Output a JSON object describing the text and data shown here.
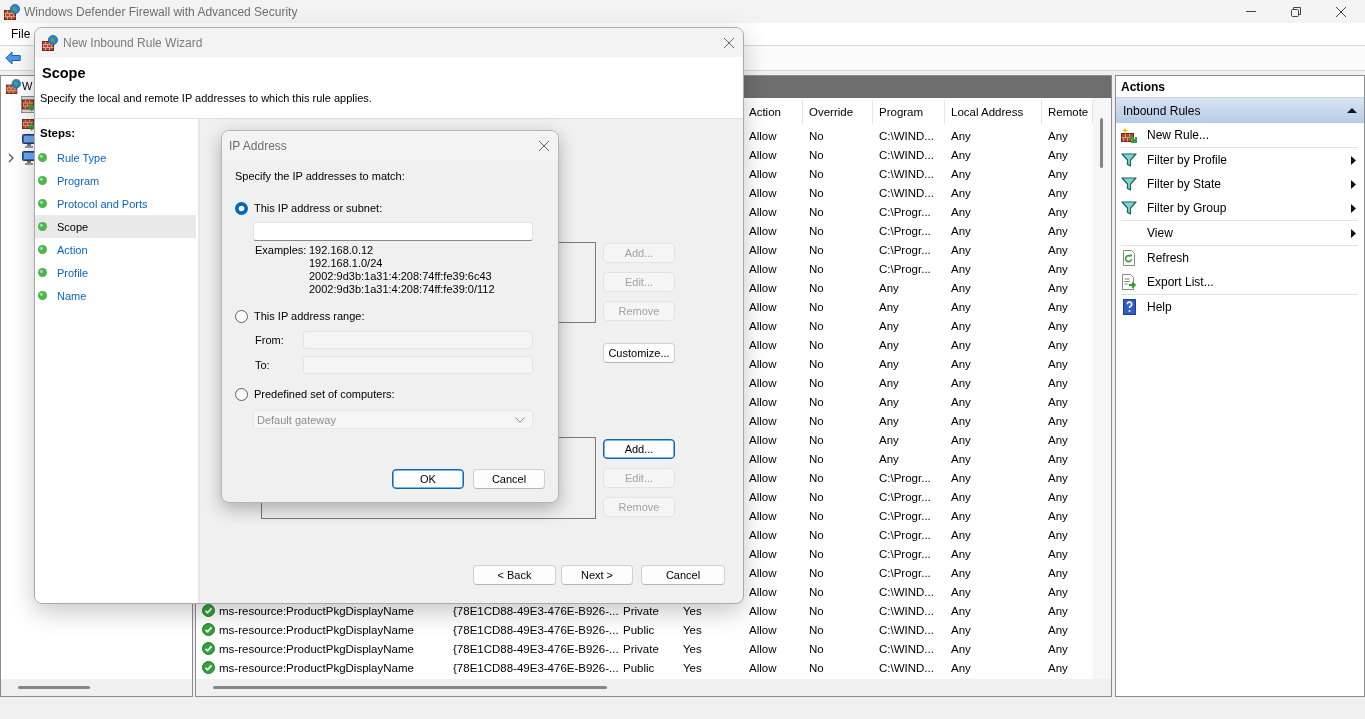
{
  "window": {
    "title": "Windows Defender Firewall with Advanced Security"
  },
  "menu": [
    "File"
  ],
  "tree": {
    "label": "W",
    "children": [
      {
        "kind": "wall",
        "selected": true,
        "collapsed": false
      },
      {
        "kind": "wall",
        "selected": false,
        "collapsed": false
      },
      {
        "kind": "monitor",
        "selected": false,
        "collapsed": false
      },
      {
        "kind": "monitor",
        "selected": false,
        "collapsed": true
      }
    ]
  },
  "table": {
    "headers": [
      "Action",
      "Override",
      "Program",
      "Local Address",
      "Remote"
    ],
    "rows": [
      {
        "action": "Allow",
        "override": "No",
        "program": "C:\\WIND...",
        "local_address": "Any",
        "remote": "Any"
      },
      {
        "action": "Allow",
        "override": "No",
        "program": "C:\\WIND...",
        "local_address": "Any",
        "remote": "Any"
      },
      {
        "action": "Allow",
        "override": "No",
        "program": "C:\\WIND...",
        "local_address": "Any",
        "remote": "Any"
      },
      {
        "action": "Allow",
        "override": "No",
        "program": "C:\\WIND...",
        "local_address": "Any",
        "remote": "Any"
      },
      {
        "action": "Allow",
        "override": "No",
        "program": "C:\\Progr...",
        "local_address": "Any",
        "remote": "Any"
      },
      {
        "action": "Allow",
        "override": "No",
        "program": "C:\\Progr...",
        "local_address": "Any",
        "remote": "Any"
      },
      {
        "action": "Allow",
        "override": "No",
        "program": "C:\\Progr...",
        "local_address": "Any",
        "remote": "Any"
      },
      {
        "action": "Allow",
        "override": "No",
        "program": "C:\\Progr...",
        "local_address": "Any",
        "remote": "Any"
      },
      {
        "action": "Allow",
        "override": "No",
        "program": "Any",
        "local_address": "Any",
        "remote": "Any"
      },
      {
        "action": "Allow",
        "override": "No",
        "program": "Any",
        "local_address": "Any",
        "remote": "Any"
      },
      {
        "action": "Allow",
        "override": "No",
        "program": "Any",
        "local_address": "Any",
        "remote": "Any"
      },
      {
        "action": "Allow",
        "override": "No",
        "program": "Any",
        "local_address": "Any",
        "remote": "Any"
      },
      {
        "action": "Allow",
        "override": "No",
        "program": "Any",
        "local_address": "Any",
        "remote": "Any"
      },
      {
        "action": "Allow",
        "override": "No",
        "program": "Any",
        "local_address": "Any",
        "remote": "Any"
      },
      {
        "action": "Allow",
        "override": "No",
        "program": "Any",
        "local_address": "Any",
        "remote": "Any"
      },
      {
        "action": "Allow",
        "override": "No",
        "program": "Any",
        "local_address": "Any",
        "remote": "Any"
      },
      {
        "action": "Allow",
        "override": "No",
        "program": "Any",
        "local_address": "Any",
        "remote": "Any"
      },
      {
        "action": "Allow",
        "override": "No",
        "program": "Any",
        "local_address": "Any",
        "remote": "Any"
      },
      {
        "action": "Allow",
        "override": "No",
        "program": "C:\\Progr...",
        "local_address": "Any",
        "remote": "Any"
      },
      {
        "action": "Allow",
        "override": "No",
        "program": "C:\\Progr...",
        "local_address": "Any",
        "remote": "Any"
      },
      {
        "action": "Allow",
        "override": "No",
        "program": "C:\\Progr...",
        "local_address": "Any",
        "remote": "Any"
      },
      {
        "action": "Allow",
        "override": "No",
        "program": "C:\\Progr...",
        "local_address": "Any",
        "remote": "Any"
      },
      {
        "action": "Allow",
        "override": "No",
        "program": "C:\\Progr...",
        "local_address": "Any",
        "remote": "Any"
      },
      {
        "action": "Allow",
        "override": "No",
        "program": "C:\\Progr...",
        "local_address": "Any",
        "remote": "Any"
      },
      {
        "action": "Allow",
        "override": "No",
        "program": "C:\\WIND...",
        "local_address": "Any",
        "remote": "Any"
      },
      {
        "column_1": "ms-resource:ProductPkgDisplayName",
        "column_2": "{78E1CD88-49E3-476E-B926-...",
        "column_3": "Private",
        "column_4": "Yes",
        "action": "Allow",
        "override": "No",
        "program": "C:\\WIND...",
        "local_address": "Any",
        "remote": "Any"
      },
      {
        "column_1": "ms-resource:ProductPkgDisplayName",
        "column_2": "{78E1CD88-49E3-476E-B926-...",
        "column_3": "Public",
        "column_4": "Yes",
        "action": "Allow",
        "override": "No",
        "program": "C:\\WIND...",
        "local_address": "Any",
        "remote": "Any"
      },
      {
        "column_1": "ms-resource:ProductPkgDisplayName",
        "column_2": "{78E1CD88-49E3-476E-B926-...",
        "column_3": "Private",
        "column_4": "Yes",
        "action": "Allow",
        "override": "No",
        "program": "C:\\WIND...",
        "local_address": "Any",
        "remote": "Any"
      },
      {
        "column_1": "ms-resource:ProductPkgDisplayName",
        "column_2": "{78E1CD88-49E3-476E-B926-...",
        "column_3": "Public",
        "column_4": "Yes",
        "action": "Allow",
        "override": "No",
        "program": "C:\\WIND...",
        "local_address": "Any",
        "remote": "Any"
      }
    ]
  },
  "actions": {
    "title": "Actions",
    "section": {
      "label": "Inbound Rules",
      "expanded": true
    },
    "groups": [
      {
        "items": [
          {
            "kind": "new",
            "label": "New Rule...",
            "submenu": false
          }
        ]
      },
      {
        "items": [
          {
            "kind": "filter",
            "label": "Filter by Profile",
            "submenu": true
          },
          {
            "kind": "filter",
            "label": "Filter by State",
            "submenu": true
          },
          {
            "kind": "filter",
            "label": "Filter by Group",
            "submenu": true
          }
        ]
      },
      {
        "items": [
          {
            "kind": "blank",
            "label": "View",
            "submenu": true
          }
        ]
      },
      {
        "items": [
          {
            "kind": "refresh",
            "label": "Refresh",
            "submenu": false
          },
          {
            "kind": "export",
            "label": "Export List...",
            "submenu": false
          }
        ]
      },
      {
        "items": [
          {
            "kind": "help",
            "label": "Help",
            "submenu": false
          }
        ]
      }
    ]
  },
  "wizard": {
    "title": "New Inbound Rule Wizard",
    "heading": "Scope",
    "description": "Specify the local and remote IP addresses to which this rule applies.",
    "steps_title": "Steps:",
    "steps": [
      {
        "label": "Rule Type",
        "selected": false
      },
      {
        "label": "Program",
        "selected": false
      },
      {
        "label": "Protocol and Ports",
        "selected": false
      },
      {
        "label": "Scope",
        "selected": true
      },
      {
        "label": "Action",
        "selected": false
      },
      {
        "label": "Profile",
        "selected": false
      },
      {
        "label": "Name",
        "selected": false
      }
    ],
    "upper_group": {
      "buttons": [
        {
          "label": "Add...",
          "disabled": true,
          "focused": false
        },
        {
          "label": "Edit...",
          "disabled": true,
          "focused": false
        },
        {
          "label": "Remove",
          "disabled": true,
          "focused": false
        }
      ]
    },
    "customize_button": {
      "label": "Customize...",
      "disabled": false
    },
    "lower_group": {
      "buttons": [
        {
          "label": "Add...",
          "disabled": false,
          "focused": true
        },
        {
          "label": "Edit...",
          "disabled": true,
          "focused": false
        },
        {
          "label": "Remove",
          "disabled": true,
          "focused": false
        }
      ]
    },
    "nav_buttons": [
      {
        "label": "< Back"
      },
      {
        "label": "Next >"
      },
      {
        "label": "Cancel"
      }
    ]
  },
  "ip_dialog": {
    "title": "IP Address",
    "prompt": "Specify the IP addresses to match:",
    "options": [
      {
        "kind": "subnet",
        "label": "This IP address or subnet:",
        "selected": true
      },
      {
        "kind": "range",
        "label": "This IP address range:",
        "selected": false
      },
      {
        "kind": "preset",
        "label": "Predefined set of computers:",
        "selected": false
      }
    ],
    "subnet_field": {
      "disabled": false
    },
    "examples_label": "Examples:",
    "examples": [
      "192.168.0.12",
      "192.168.1.0/24",
      "2002:9d3b:1a31:4:208:74ff:fe39:6c43",
      "2002:9d3b:1a31:4:208:74ff:fe39:0/112"
    ],
    "range_fields": [
      {
        "label": "From:",
        "disabled": true
      },
      {
        "label": "To:",
        "disabled": true
      }
    ],
    "computer_set": {
      "value": "Default gateway",
      "disabled": true
    },
    "buttons": [
      {
        "label": "OK",
        "focused": true
      },
      {
        "label": "Cancel",
        "focused": false
      }
    ]
  }
}
